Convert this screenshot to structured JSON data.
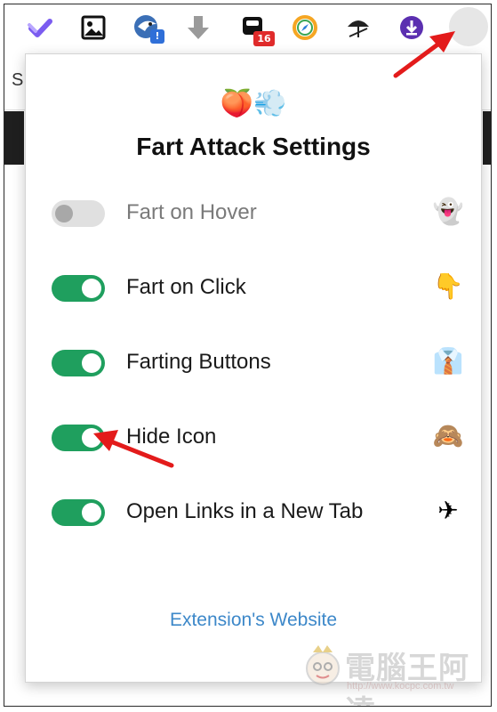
{
  "toolbar": {
    "icons": [
      {
        "name": "checkmark-extension-icon",
        "glyph": "✔"
      },
      {
        "name": "image-extension-icon",
        "glyph": "▣"
      },
      {
        "name": "eagle-extension-icon",
        "badge": "!"
      },
      {
        "name": "download-arrow-extension-icon",
        "glyph": "⬇"
      },
      {
        "name": "notification-extension-icon",
        "badge": "16"
      },
      {
        "name": "compass-extension-icon",
        "glyph": "◐"
      },
      {
        "name": "umbrella-extension-icon",
        "glyph": "☂"
      },
      {
        "name": "download-circle-extension-icon",
        "glyph": "⬇"
      },
      {
        "name": "fart-attack-extension-icon",
        "glyph": ""
      }
    ]
  },
  "popup": {
    "header_emoji": "🍑💨",
    "title": "Fart Attack Settings",
    "settings": [
      {
        "label": "Fart on Hover",
        "enabled": false,
        "emoji": "👻"
      },
      {
        "label": "Fart on Click",
        "enabled": true,
        "emoji": "👇"
      },
      {
        "label": "Farting Buttons",
        "enabled": true,
        "emoji": "👔"
      },
      {
        "label": "Hide Icon",
        "enabled": true,
        "emoji": "🙈"
      },
      {
        "label": "Open Links in a New Tab",
        "enabled": true,
        "emoji": "✈"
      }
    ],
    "link_text": "Extension's Website"
  },
  "background": {
    "partial_letter": "S"
  },
  "watermark": {
    "text": "電腦王阿達",
    "url": "http://www.kocpc.com.tw"
  },
  "colors": {
    "toggle_on": "#1f9f5e",
    "toggle_off": "#e0e0e0",
    "link": "#3d88c9",
    "annotation_arrow": "#e31b1b"
  }
}
